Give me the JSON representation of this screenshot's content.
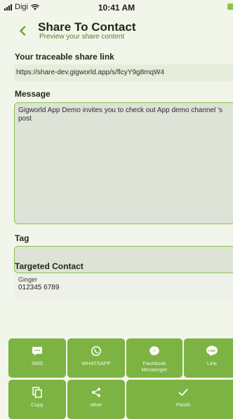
{
  "status_bar": {
    "carrier": "Digi",
    "time": "10:41 AM"
  },
  "header": {
    "title": "Share To Contact",
    "subtitle": "Preview your share content"
  },
  "share_link": {
    "label": "Your traceable share link",
    "url": "https://share-dev.gigworld.app/s/flcyY9g8mqW4"
  },
  "message": {
    "label": "Message",
    "text": "Gigworld App Demo invites you to check out App demo channel 's post"
  },
  "tag": {
    "label": "Tag",
    "value": ""
  },
  "targeted_contact": {
    "label": "Targeted Contact",
    "name": "Ginger",
    "phone": "012345 6789"
  },
  "share_options": [
    {
      "label": "SMS",
      "icon": "sms-icon"
    },
    {
      "label": "WHATSAPP",
      "icon": "whatsapp-icon"
    },
    {
      "label": "Facebook Messenger",
      "icon": "messenger-icon"
    },
    {
      "label": "Line",
      "icon": "line-icon"
    },
    {
      "label": "Copy",
      "icon": "copy-icon"
    },
    {
      "label": "other",
      "icon": "share-icon"
    },
    {
      "label": "Finish",
      "icon": "check-icon"
    }
  ],
  "colors": {
    "accent": "#7cb342",
    "border": "#8bc34a",
    "background": "#f1f5ea",
    "input_bg": "#dde3d6"
  }
}
